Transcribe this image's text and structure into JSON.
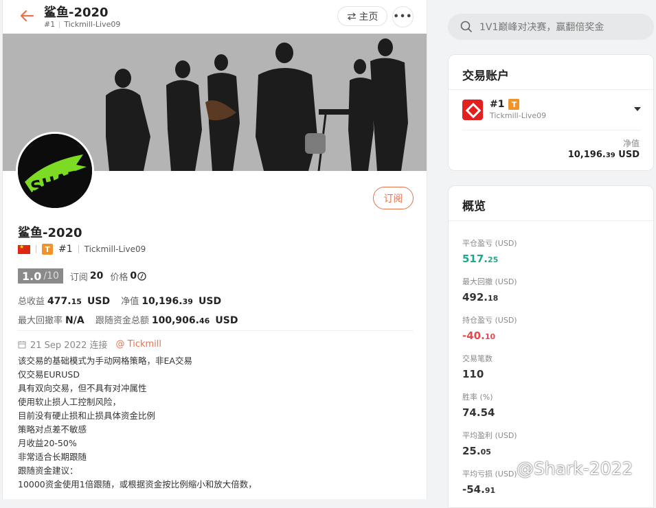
{
  "header": {
    "title": "鲨鱼-2020",
    "rank": "#1",
    "account": "Tickmill-Live09",
    "main_button": "主页",
    "more_button": "•••"
  },
  "profile": {
    "name": "鲨鱼-2020",
    "rank": "#1",
    "account": "Tickmill-Live09",
    "badge": "T",
    "avatar_text": "SHARK",
    "subscribe_button": "订阅",
    "score": "1.0",
    "score_den": "/10",
    "subscriptions_label": "订阅",
    "subscriptions_value": "20",
    "price_label": "价格",
    "price_value": "0",
    "total_profit_label": "总收益",
    "total_profit_int": "477.",
    "total_profit_dec": "15",
    "total_profit_unit": "USD",
    "net_value_label": "净值",
    "net_value_int": "10,196.",
    "net_value_dec": "39",
    "net_value_unit": "USD",
    "max_drawdown_label": "最大回撤率",
    "max_drawdown_value": "N/A",
    "follow_funds_label": "跟随资金总额",
    "follow_funds_int": "100,906.",
    "follow_funds_dec": "46",
    "follow_funds_unit": "USD",
    "date": "21 Sep 2022 连接",
    "broker_link": "@ Tickmill",
    "description": [
      "该交易的基础模式为手动网格策略，非EA交易",
      "仅交易EURUSD",
      "具有双向交易，但不具有对冲属性",
      "使用软止损人工控制风险，",
      "目前没有硬止损和止损具体资金比例",
      "策略对点差不敏感",
      "月收益20-50%",
      "非常适合长期跟随",
      "跟随资金建议：",
      "10000资金使用1倍跟随，或根据资金按比例缩小和放大倍数，"
    ]
  },
  "search": {
    "placeholder": "1V1巅峰对决赛，赢翻倍奖金"
  },
  "trading_account": {
    "title": "交易账户",
    "rank": "#1",
    "badge": "T",
    "account": "Tickmill-Live09",
    "net_label": "净值",
    "net_int": "10,196.",
    "net_dec": "39",
    "net_unit": "USD"
  },
  "overview": {
    "title": "概览",
    "items": [
      {
        "label": "平仓盈亏 (USD)",
        "int": "517.",
        "dec": "25",
        "color": "#1aaa8a"
      },
      {
        "label": "最大回撤 (USD)",
        "int": "492.",
        "dec": "18",
        "color": "#333333"
      },
      {
        "label": "持仓盈亏 (USD)",
        "int": "-40.",
        "dec": "10",
        "color": "#e5484d"
      },
      {
        "label": "交易笔数",
        "int": "110",
        "dec": "",
        "color": "#333333"
      },
      {
        "label": "胜率 (%)",
        "int": "74.54",
        "dec": "",
        "color": "#333333"
      },
      {
        "label": "平均盈利 (USD)",
        "int": "25.",
        "dec": "05",
        "color": "#333333"
      },
      {
        "label": "平均亏损 (USD)",
        "int": "-54.",
        "dec": "91",
        "color": "#333333"
      }
    ]
  },
  "watermark": "@Shark-2022"
}
